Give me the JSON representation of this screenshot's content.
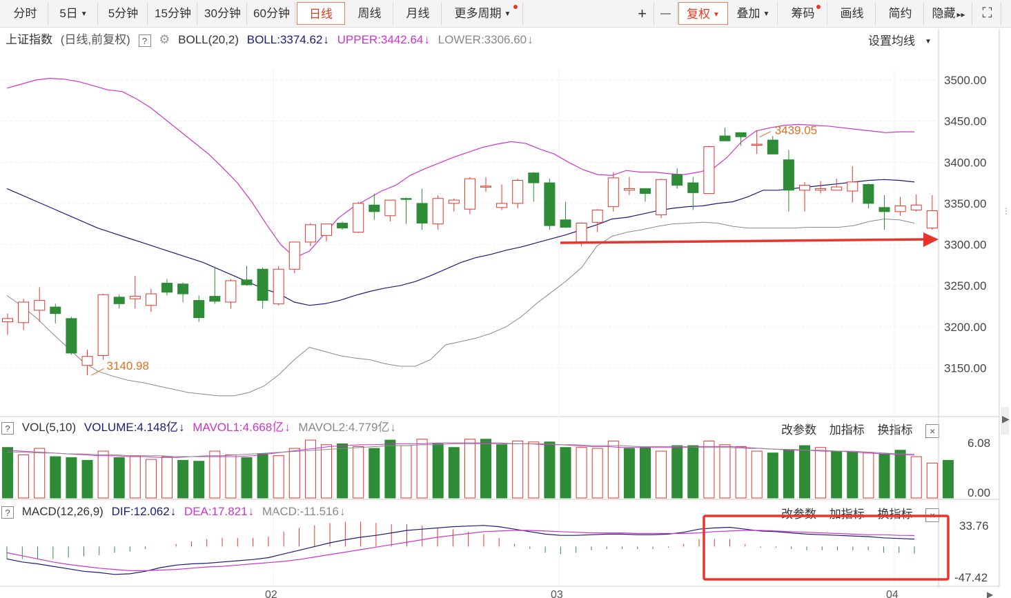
{
  "toolbar": {
    "periods": [
      "分时",
      "5日",
      "5分钟",
      "15分钟",
      "30分钟",
      "60分钟",
      "日线",
      "周线",
      "月线",
      "更多周期"
    ],
    "actions": [
      "复权",
      "叠加",
      "筹码",
      "画线",
      "简约",
      "隐藏"
    ],
    "plus": "+",
    "minus": "—",
    "fullscreen": "⛶",
    "hide_arrows": "▸▸"
  },
  "main_panel": {
    "title": "上证指数",
    "mode": "(日线,前复权)",
    "help": "?",
    "indicator": "BOLL(20,2)",
    "boll": "BOLL:3374.62",
    "upper": "UPPER:3442.64",
    "lower": "LOWER:3306.60",
    "setting": "设置均线",
    "price_labels": [
      "3500.00",
      "3450.00",
      "3400.00",
      "3350.00",
      "3300.00",
      "3250.00",
      "3200.00",
      "3150.00"
    ],
    "high_label": "3439.05",
    "low_label": "3140.98"
  },
  "vol_panel": {
    "indicator": "VOL(5,10)",
    "volume": "VOLUME:4.148亿",
    "mavol1": "MAVOL1:4.668亿",
    "mavol2": "MAVOL2:4.779亿",
    "max": "6.08",
    "min": "0.00",
    "edit": "改参数",
    "add": "加指标",
    "switch": "换指标",
    "close": "×"
  },
  "macd_panel": {
    "indicator": "MACD(12,26,9)",
    "dif": "DIF:12.062",
    "dea": "DEA:17.821",
    "macd": "MACD:-11.516",
    "max": "33.76",
    "min": "-47.42",
    "edit": "改参数",
    "add": "加指标",
    "switch": "换指标",
    "close": "×"
  },
  "x_axis": {
    "labels": [
      "02",
      "03",
      "04"
    ]
  },
  "colors": {
    "up": "#e8342b",
    "down": "#2e8b36",
    "boll_mid": "#1a1a7a",
    "boll_upper": "#cc33cc",
    "boll_lower": "#888888",
    "annotation": "#e8342b",
    "accent": "#e03c1e"
  },
  "chart_data": {
    "type": "candlestick",
    "candles": [
      {
        "o": 3206,
        "h": 3216,
        "l": 3190,
        "c": 3210
      },
      {
        "o": 3205,
        "h": 3234,
        "l": 3196,
        "c": 3230
      },
      {
        "o": 3220,
        "h": 3248,
        "l": 3206,
        "c": 3232
      },
      {
        "o": 3224,
        "h": 3228,
        "l": 3204,
        "c": 3216
      },
      {
        "o": 3210,
        "h": 3212,
        "l": 3166,
        "c": 3168
      },
      {
        "o": 3153,
        "h": 3172,
        "l": 3140.98,
        "c": 3164
      },
      {
        "o": 3165,
        "h": 3240,
        "l": 3160,
        "c": 3239
      },
      {
        "o": 3236,
        "h": 3239,
        "l": 3222,
        "c": 3228
      },
      {
        "o": 3234,
        "h": 3262,
        "l": 3222,
        "c": 3237
      },
      {
        "o": 3226,
        "h": 3246,
        "l": 3218,
        "c": 3240
      },
      {
        "o": 3253,
        "h": 3258,
        "l": 3238,
        "c": 3242
      },
      {
        "o": 3252,
        "h": 3254,
        "l": 3230,
        "c": 3240
      },
      {
        "o": 3232,
        "h": 3238,
        "l": 3206,
        "c": 3211
      },
      {
        "o": 3237,
        "h": 3273,
        "l": 3228,
        "c": 3231
      },
      {
        "o": 3230,
        "h": 3258,
        "l": 3222,
        "c": 3256
      },
      {
        "o": 3257,
        "h": 3274,
        "l": 3250,
        "c": 3251
      },
      {
        "o": 3270,
        "h": 3272,
        "l": 3222,
        "c": 3232
      },
      {
        "o": 3228,
        "h": 3274,
        "l": 3226,
        "c": 3270
      },
      {
        "o": 3270,
        "h": 3303,
        "l": 3265,
        "c": 3303
      },
      {
        "o": 3303,
        "h": 3326,
        "l": 3298,
        "c": 3324
      },
      {
        "o": 3311,
        "h": 3324,
        "l": 3304,
        "c": 3325
      },
      {
        "o": 3326,
        "h": 3328,
        "l": 3318,
        "c": 3320
      },
      {
        "o": 3315,
        "h": 3352,
        "l": 3314,
        "c": 3350
      },
      {
        "o": 3348,
        "h": 3362,
        "l": 3330,
        "c": 3340
      },
      {
        "o": 3335,
        "h": 3352,
        "l": 3328,
        "c": 3354
      },
      {
        "o": 3356,
        "h": 3357,
        "l": 3325,
        "c": 3355
      },
      {
        "o": 3350,
        "h": 3368,
        "l": 3318,
        "c": 3326
      },
      {
        "o": 3325,
        "h": 3360,
        "l": 3318,
        "c": 3356
      },
      {
        "o": 3350,
        "h": 3356,
        "l": 3340,
        "c": 3354
      },
      {
        "o": 3343,
        "h": 3382,
        "l": 3337,
        "c": 3380
      },
      {
        "o": 3370,
        "h": 3382,
        "l": 3364,
        "c": 3371
      },
      {
        "o": 3345,
        "h": 3373,
        "l": 3342,
        "c": 3350
      },
      {
        "o": 3350,
        "h": 3380,
        "l": 3344,
        "c": 3378
      },
      {
        "o": 3387,
        "h": 3388,
        "l": 3352,
        "c": 3375
      },
      {
        "o": 3375,
        "h": 3380,
        "l": 3318,
        "c": 3323
      },
      {
        "o": 3330,
        "h": 3352,
        "l": 3320,
        "c": 3321
      },
      {
        "o": 3302,
        "h": 3327,
        "l": 3298,
        "c": 3326
      },
      {
        "o": 3327,
        "h": 3343,
        "l": 3315,
        "c": 3342
      },
      {
        "o": 3346,
        "h": 3388,
        "l": 3340,
        "c": 3381
      },
      {
        "o": 3366,
        "h": 3382,
        "l": 3360,
        "c": 3368
      },
      {
        "o": 3368,
        "h": 3364,
        "l": 3352,
        "c": 3362
      },
      {
        "o": 3336,
        "h": 3380,
        "l": 3332,
        "c": 3379
      },
      {
        "o": 3385,
        "h": 3393,
        "l": 3368,
        "c": 3372
      },
      {
        "o": 3375,
        "h": 3382,
        "l": 3342,
        "c": 3363
      },
      {
        "o": 3362,
        "h": 3420,
        "l": 3362,
        "c": 3419
      },
      {
        "o": 3432,
        "h": 3442,
        "l": 3426,
        "c": 3426
      },
      {
        "o": 3436,
        "h": 3436,
        "l": 3420,
        "c": 3431
      },
      {
        "o": 3422,
        "h": 3439.05,
        "l": 3410,
        "c": 3422
      },
      {
        "o": 3427,
        "h": 3432,
        "l": 3410,
        "c": 3410
      },
      {
        "o": 3403,
        "h": 3415,
        "l": 3340,
        "c": 3366
      },
      {
        "o": 3366,
        "h": 3376,
        "l": 3340,
        "c": 3372
      },
      {
        "o": 3366,
        "h": 3377,
        "l": 3362,
        "c": 3368
      },
      {
        "o": 3366,
        "h": 3380,
        "l": 3366,
        "c": 3370
      },
      {
        "o": 3365,
        "h": 3395,
        "l": 3351,
        "c": 3376
      },
      {
        "o": 3373,
        "h": 3374,
        "l": 3344,
        "c": 3350
      },
      {
        "o": 3345,
        "h": 3360,
        "l": 3318,
        "c": 3340
      },
      {
        "o": 3340,
        "h": 3358,
        "l": 3335,
        "c": 3347
      },
      {
        "o": 3342,
        "h": 3361,
        "l": 3340,
        "c": 3348
      },
      {
        "o": 3320,
        "h": 3360,
        "l": 3318,
        "c": 3341
      }
    ],
    "boll_mid": [
      3368,
      3360,
      3352,
      3344,
      3336,
      3328,
      3320,
      3314,
      3308,
      3302,
      3296,
      3290,
      3284,
      3278,
      3270,
      3262,
      3254,
      3246,
      3240,
      3230,
      3226,
      3228,
      3232,
      3238,
      3243,
      3247,
      3250,
      3255,
      3262,
      3270,
      3278,
      3284,
      3288,
      3293,
      3297,
      3302,
      3307,
      3312,
      3318,
      3324,
      3331,
      3333,
      3337,
      3341,
      3344,
      3346,
      3347,
      3350,
      3352,
      3358,
      3366,
      3366,
      3368,
      3370,
      3372,
      3374,
      3376,
      3378,
      3379,
      3378,
      3376
    ],
    "boll_upper": [
      3490,
      3495,
      3500,
      3502,
      3501,
      3498,
      3493,
      3488,
      3486,
      3477,
      3466,
      3452,
      3438,
      3424,
      3410,
      3393,
      3375,
      3352,
      3325,
      3300,
      3284,
      3292,
      3312,
      3332,
      3345,
      3355,
      3365,
      3372,
      3384,
      3392,
      3399,
      3406,
      3412,
      3418,
      3422,
      3425,
      3423,
      3416,
      3410,
      3400,
      3391,
      3385,
      3384,
      3390,
      3388,
      3388,
      3386,
      3385,
      3388,
      3392,
      3406,
      3425,
      3438,
      3442,
      3445,
      3446,
      3445,
      3444,
      3442,
      3440,
      3438,
      3436,
      3437,
      3437
    ],
    "boll_lower": [
      3238,
      3225,
      3210,
      3192,
      3175,
      3158,
      3146,
      3140,
      3135,
      3132,
      3128,
      3124,
      3120,
      3118,
      3116,
      3116,
      3120,
      3128,
      3142,
      3160,
      3175,
      3170,
      3165,
      3162,
      3160,
      3155,
      3152,
      3152,
      3160,
      3178,
      3182,
      3186,
      3192,
      3200,
      3212,
      3228,
      3242,
      3256,
      3272,
      3298,
      3310,
      3315,
      3318,
      3322,
      3325,
      3326,
      3327,
      3326,
      3322,
      3320,
      3320,
      3320,
      3320,
      3321,
      3321,
      3321,
      3323,
      3328,
      3331,
      3330,
      3326
    ],
    "volume": [
      {
        "v": 5.5,
        "up": false
      },
      {
        "v": 4.7,
        "up": true
      },
      {
        "v": 5.4,
        "up": true
      },
      {
        "v": 4.5,
        "up": false
      },
      {
        "v": 4.4,
        "up": false
      },
      {
        "v": 4.1,
        "up": false
      },
      {
        "v": 5.1,
        "up": true
      },
      {
        "v": 4.4,
        "up": false
      },
      {
        "v": 4.6,
        "up": true
      },
      {
        "v": 4.2,
        "up": true
      },
      {
        "v": 4.5,
        "up": true
      },
      {
        "v": 4.1,
        "up": false
      },
      {
        "v": 4.0,
        "up": false
      },
      {
        "v": 5.1,
        "up": true
      },
      {
        "v": 4.7,
        "up": true
      },
      {
        "v": 4.4,
        "up": false
      },
      {
        "v": 4.8,
        "up": false
      },
      {
        "v": 4.6,
        "up": true
      },
      {
        "v": 5.4,
        "up": true
      },
      {
        "v": 6.3,
        "up": true
      },
      {
        "v": 5.8,
        "up": true
      },
      {
        "v": 5.9,
        "up": false
      },
      {
        "v": 5.6,
        "up": true
      },
      {
        "v": 5.4,
        "up": false
      },
      {
        "v": 6.3,
        "up": false
      },
      {
        "v": 5.7,
        "up": true
      },
      {
        "v": 6.4,
        "up": true
      },
      {
        "v": 5.9,
        "up": false
      },
      {
        "v": 5.5,
        "up": false
      },
      {
        "v": 6.4,
        "up": true
      },
      {
        "v": 6.4,
        "up": false
      },
      {
        "v": 5.8,
        "up": false
      },
      {
        "v": 6.2,
        "up": true
      },
      {
        "v": 6.1,
        "up": true
      },
      {
        "v": 6.1,
        "up": false
      },
      {
        "v": 5.5,
        "up": false
      },
      {
        "v": 5.5,
        "up": true
      },
      {
        "v": 5.4,
        "up": true
      },
      {
        "v": 6.2,
        "up": true
      },
      {
        "v": 5.4,
        "up": false
      },
      {
        "v": 5.5,
        "up": false
      },
      {
        "v": 5.1,
        "up": true
      },
      {
        "v": 5.7,
        "up": false
      },
      {
        "v": 5.7,
        "up": false
      },
      {
        "v": 6.2,
        "up": true
      },
      {
        "v": 5.8,
        "up": true
      },
      {
        "v": 5.6,
        "up": true
      },
      {
        "v": 5.1,
        "up": true
      },
      {
        "v": 4.9,
        "up": false
      },
      {
        "v": 5.2,
        "up": false
      },
      {
        "v": 5.7,
        "up": false
      },
      {
        "v": 5.5,
        "up": true
      },
      {
        "v": 5.1,
        "up": false
      },
      {
        "v": 5.0,
        "up": false
      },
      {
        "v": 4.9,
        "up": true
      },
      {
        "v": 4.8,
        "up": false
      },
      {
        "v": 5.2,
        "up": false
      },
      {
        "v": 4.5,
        "up": true
      },
      {
        "v": 3.8,
        "up": true
      },
      {
        "v": 4.1,
        "up": false
      }
    ],
    "mavol1": [
      5.2,
      5.1,
      5.0,
      4.9,
      4.8,
      4.7,
      4.6,
      4.6,
      4.5,
      4.5,
      4.4,
      4.4,
      4.5,
      4.5,
      4.5,
      4.5,
      4.6,
      4.8,
      5.0,
      5.2,
      5.4,
      5.6,
      5.7,
      5.8,
      5.8,
      5.9,
      5.9,
      5.9,
      6.0,
      6.0,
      6.0,
      6.0,
      6.0,
      5.9,
      5.9,
      5.8,
      5.8,
      5.7,
      5.6,
      5.6,
      5.5,
      5.5,
      5.5,
      5.5,
      5.5,
      5.6,
      5.6,
      5.6,
      5.5,
      5.4,
      5.3,
      5.2,
      5.2,
      5.1,
      5.1,
      5.0,
      4.9,
      4.8,
      4.7,
      4.668
    ],
    "mavol2": [
      5.0,
      5.0,
      4.9,
      4.9,
      4.8,
      4.8,
      4.7,
      4.7,
      4.6,
      4.6,
      4.6,
      4.5,
      4.5,
      4.6,
      4.6,
      4.7,
      4.8,
      4.9,
      5.0,
      5.1,
      5.2,
      5.3,
      5.4,
      5.5,
      5.6,
      5.7,
      5.7,
      5.8,
      5.8,
      5.9,
      5.9,
      5.9,
      5.9,
      5.9,
      5.9,
      5.9,
      5.8,
      5.8,
      5.7,
      5.7,
      5.7,
      5.6,
      5.6,
      5.6,
      5.6,
      5.5,
      5.5,
      5.5,
      5.4,
      5.4,
      5.3,
      5.3,
      5.2,
      5.2,
      5.1,
      5.1,
      5.0,
      4.9,
      4.8,
      4.779
    ],
    "dif": [
      -20,
      -25,
      -28,
      -32,
      -36,
      -40,
      -42,
      -45,
      -44,
      -40,
      -34,
      -30,
      -28,
      -27,
      -25,
      -23,
      -21,
      -18,
      -12,
      -6,
      0,
      6,
      11,
      15,
      18,
      22,
      26,
      28,
      30,
      32,
      33,
      34,
      32,
      28,
      24,
      20,
      18,
      18,
      19,
      20,
      20,
      19,
      19,
      20,
      23,
      28,
      30,
      31,
      28,
      25,
      24,
      22,
      20,
      19,
      18,
      17,
      16,
      14,
      13,
      12
    ],
    "dea": [
      -10,
      -15,
      -20,
      -25,
      -29,
      -32,
      -35,
      -37,
      -39,
      -39,
      -38,
      -37,
      -35,
      -33,
      -32,
      -30,
      -28,
      -26,
      -24,
      -21,
      -17,
      -13,
      -9,
      -5,
      -1,
      3,
      7,
      11,
      15,
      18,
      21,
      24,
      25,
      26,
      26,
      25,
      24,
      23,
      22,
      22,
      22,
      21,
      21,
      21,
      21,
      22,
      24,
      25,
      26,
      26,
      25,
      24,
      23,
      22,
      21,
      20,
      19,
      19,
      18,
      17.8
    ],
    "macd": [
      -20,
      -20,
      -20,
      -20,
      -18,
      -16,
      -14,
      -10,
      -8,
      -4,
      0,
      4,
      8,
      12,
      14,
      14,
      14,
      16,
      24,
      30,
      34,
      38,
      40,
      40,
      38,
      36,
      36,
      34,
      30,
      28,
      24,
      20,
      14,
      4,
      -4,
      -10,
      -12,
      -10,
      -6,
      -4,
      -4,
      -4,
      -4,
      -2,
      4,
      12,
      12,
      12,
      4,
      -2,
      -2,
      -4,
      -6,
      -6,
      -6,
      -6,
      -6,
      -10,
      -10,
      -11.5
    ]
  }
}
